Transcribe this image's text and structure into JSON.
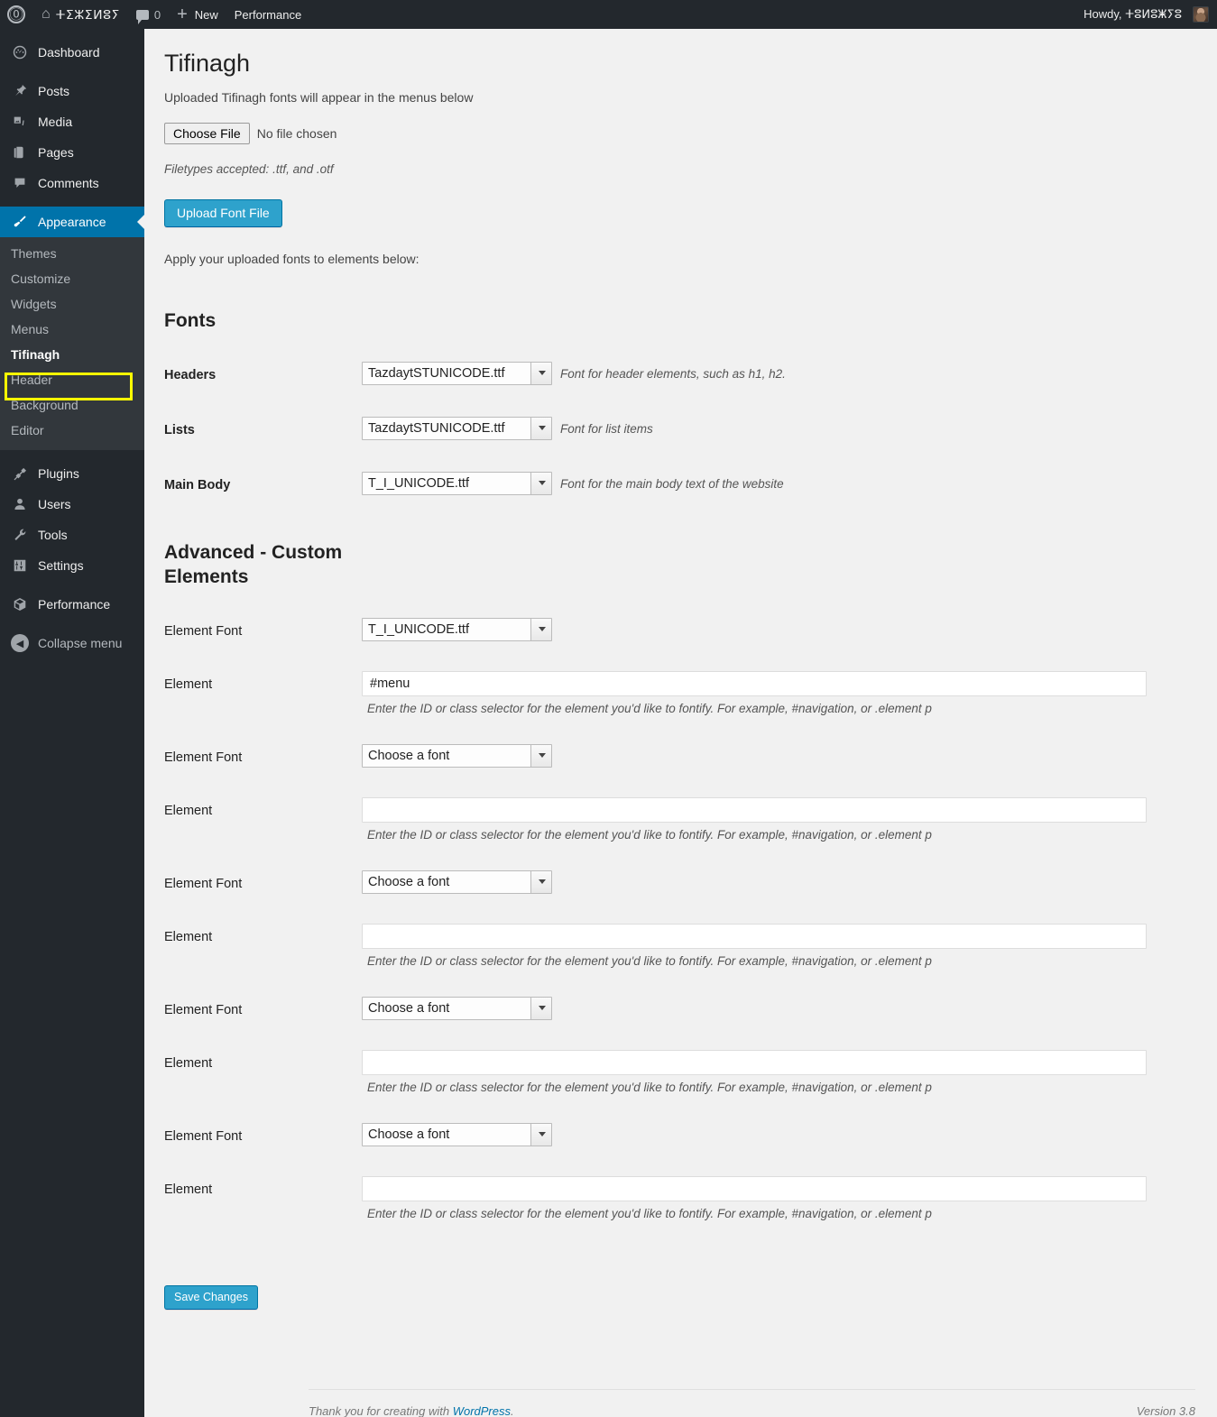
{
  "adminbar": {
    "wp_logo_icon": "wordpress-logo-icon",
    "home_icon": "house-icon",
    "site_title": "ⵜⵉⵣⵉⵍⵓⵢ",
    "comments_icon": "comment-bubble-icon",
    "comment_count": "0",
    "new_icon": "plus-icon",
    "new_label": "New",
    "performance_label": "Performance",
    "howdy": "Howdy, ⵜⵓⵍⵓⵥⵢⵓ",
    "avatar": "avatar"
  },
  "sidebar": {
    "items": [
      {
        "label": "Dashboard",
        "icon": "dashboard-icon"
      },
      {
        "label": "Posts",
        "icon": "pin-icon"
      },
      {
        "label": "Media",
        "icon": "media-icon"
      },
      {
        "label": "Pages",
        "icon": "pages-icon"
      },
      {
        "label": "Comments",
        "icon": "comment-icon"
      },
      {
        "label": "Appearance",
        "icon": "paintbrush-icon"
      }
    ],
    "submenu": [
      "Themes",
      "Customize",
      "Widgets",
      "Menus",
      "Tifinagh",
      "Header",
      "Background",
      "Editor"
    ],
    "current_submenu": "Tifinagh",
    "items_lower": [
      {
        "label": "Plugins",
        "icon": "plug-icon"
      },
      {
        "label": "Users",
        "icon": "user-icon"
      },
      {
        "label": "Tools",
        "icon": "wrench-icon"
      },
      {
        "label": "Settings",
        "icon": "sliders-icon"
      },
      {
        "label": "Performance",
        "icon": "cube-icon"
      }
    ],
    "collapse_label": "Collapse menu",
    "collapse_icon": "collapse-arrow-icon",
    "highlight_color": "#ffff00",
    "active_color": "#0073aa"
  },
  "main": {
    "page_title": "Tifinagh",
    "lead": "Uploaded Tifinagh fonts will appear in the menus below",
    "file_input": {
      "button_label": "Choose File",
      "status": "No file chosen"
    },
    "filetypes_note": "Filetypes accepted: .ttf, and .otf",
    "upload_button": "Upload Font File",
    "apply_note": "Apply your uploaded fonts to elements below:",
    "fonts_section_title": "Fonts",
    "font_rows": [
      {
        "label": "Headers",
        "value": "TazdaytSTUNICODE.ttf",
        "hint": "Font for header elements, such as h1, h2."
      },
      {
        "label": "Lists",
        "value": "TazdaytSTUNICODE.ttf",
        "hint": "Font for list items"
      },
      {
        "label": "Main Body",
        "value": "T_I_UNICODE.ttf",
        "hint": "Font for the main body text of the website"
      }
    ],
    "advanced_section_title": "Advanced - Custom Elements",
    "element_font_label": "Element Font",
    "element_label": "Element",
    "element_hint": "Enter the ID or class selector for the element you'd like to fontify. For example, #navigation, or .element p",
    "choose_a_font": "Choose a font",
    "custom_rows": [
      {
        "font": "T_I_UNICODE.ttf",
        "element": "#menu"
      },
      {
        "font": "Choose a font",
        "element": ""
      },
      {
        "font": "Choose a font",
        "element": ""
      },
      {
        "font": "Choose a font",
        "element": ""
      },
      {
        "font": "Choose a font",
        "element": ""
      }
    ],
    "save_button": "Save Changes"
  },
  "footer": {
    "thanks_prefix": "Thank you for creating with ",
    "wordpress_link": "WordPress",
    "thanks_suffix": ".",
    "version": "Version 3.8"
  },
  "colors": {
    "admin_bar": "#23282d",
    "sidebar": "#23282d",
    "submenu": "#32373c",
    "accent": "#2ea2cc",
    "content_bg": "#f1f1f1"
  }
}
